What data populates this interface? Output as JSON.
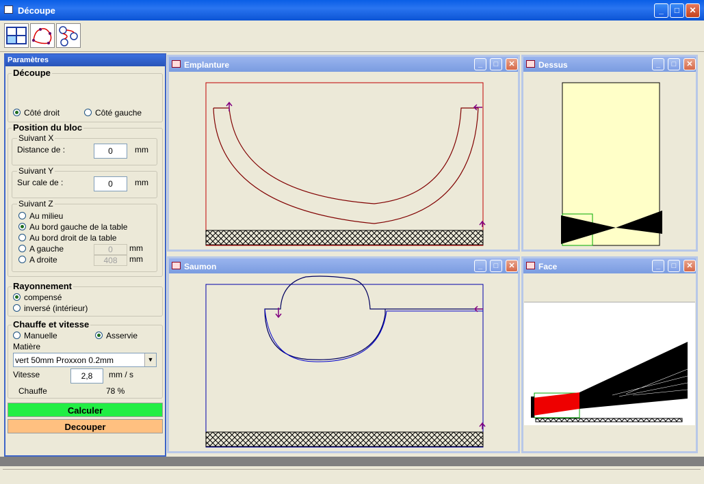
{
  "window": {
    "title": "Découpe"
  },
  "panel": {
    "title": "Paramètres",
    "decoupe": {
      "label": "Découpe",
      "cote_droit": "Côté droit",
      "cote_gauche": "Côté gauche"
    },
    "position": {
      "label": "Position du bloc",
      "x": {
        "label": "Suivant X",
        "field": "Distance de :",
        "value": "0",
        "unit": "mm"
      },
      "y": {
        "label": "Suivant Y",
        "field": "Sur cale de :",
        "value": "0",
        "unit": "mm"
      },
      "z": {
        "label": "Suivant Z",
        "au_milieu": "Au milieu",
        "bord_gauche": "Au bord gauche de la table",
        "bord_droit": "Au bord droit de la table",
        "a_gauche": "A gauche",
        "a_gauche_value": "0",
        "a_droite": "A droite",
        "a_droite_value": "408",
        "unit": "mm"
      }
    },
    "rayonnement": {
      "label": "Rayonnement",
      "compense": "compensé",
      "inverse": "inversé (intérieur)"
    },
    "chauffe": {
      "label": "Chauffe et vitesse",
      "manuelle": "Manuelle",
      "asservie": "Asservie",
      "matiere_label": "Matière",
      "matiere_value": "vert 50mm Proxxon 0.2mm",
      "vitesse_label": "Vitesse",
      "vitesse_value": "2,8",
      "vitesse_unit": "mm / s",
      "chauffe_label": "Chauffe",
      "chauffe_value": "78 %"
    },
    "calculer": "Calculer",
    "decouper": "Decouper"
  },
  "windows": {
    "emplanture": "Emplanture",
    "dessus": "Dessus",
    "saumon": "Saumon",
    "face": "Face"
  },
  "colors": {
    "emplanture_stroke": "#c00000",
    "saumon_stroke": "#0000aa",
    "arrow": "#800080",
    "calculer_bg": "#22ee44",
    "decouper_bg": "#ffc080",
    "dessus_fill": "#ffffc8",
    "face_red": "#ee0000"
  }
}
